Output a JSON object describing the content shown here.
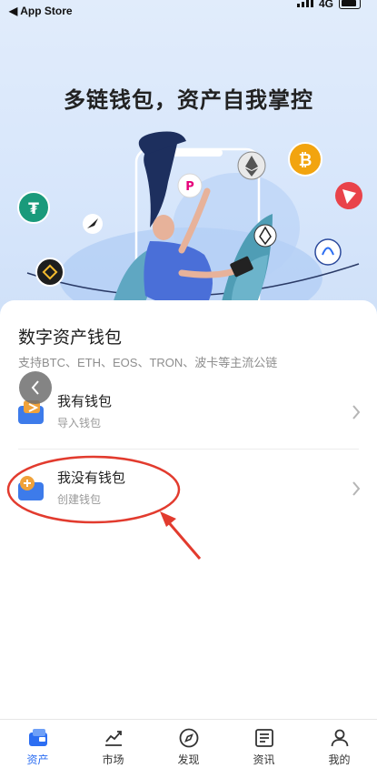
{
  "status_bar": {
    "back_app": "App Store",
    "network": "4G"
  },
  "hero": {
    "title": "多链钱包，资产自我掌控"
  },
  "sheet": {
    "title": "数字资产钱包",
    "subtitle": "支持BTC、ETH、EOS、TRON、波卡等主流公链",
    "options": [
      {
        "label": "我有钱包",
        "sub": "导入钱包",
        "icon": "wallet-import-icon"
      },
      {
        "label": "我没有钱包",
        "sub": "创建钱包",
        "icon": "wallet-create-icon"
      }
    ]
  },
  "tabbar": {
    "tabs": [
      {
        "label": "资产",
        "icon": "wallet-icon",
        "active": true
      },
      {
        "label": "市场",
        "icon": "chart-icon",
        "active": false
      },
      {
        "label": "发现",
        "icon": "compass-icon",
        "active": false
      },
      {
        "label": "资讯",
        "icon": "news-icon",
        "active": false
      },
      {
        "label": "我的",
        "icon": "user-icon",
        "active": false
      }
    ]
  },
  "colors": {
    "accent": "#2c6ef2",
    "annotation": "#e23b2e",
    "wallet_blue": "#3d7bea",
    "wallet_orange": "#f0a23a"
  }
}
